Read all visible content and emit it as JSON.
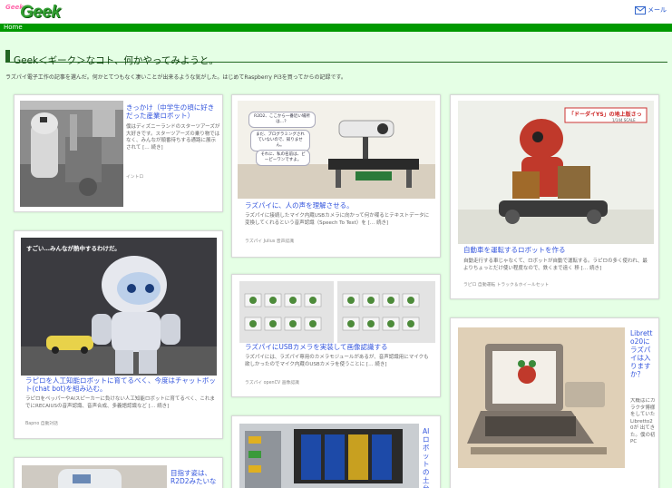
{
  "site": {
    "logo_small": "Geek",
    "logo_big": "Geek",
    "mail_label": "メール",
    "nav_label": "Home"
  },
  "headline": "Geek＜ギーク＞なコト、何かやってみようと。",
  "intro": "ラズパイ電子工作の記事を選んだ。何かとてつもなく凄いことが出来るような気がした。はじめてRaspberry Pi3を買ってからの記録です。",
  "cards": [
    {
      "title": "きっかけ（中学生の頃に好きだった産業ロボット）",
      "desc": "僕はディズニーランドのスターツアーズが大好きです。スターツアーズの乗り物ではなく、みんなが順番待ちする通路に展示されて [… 続き]",
      "tags": "イントロ"
    },
    {
      "title": "ラズパイに、人の声を理解させる。",
      "desc": "ラズパイに接続したマイク内蔵USBカメラに向かって何か喋るとテキストデータに変換してくれるという音声認識（Speech To Text）を [… 続き]",
      "tags": "ラズパイ Julius 音声認識",
      "bubble_1": "R2D2、ここから一番近い場所は…？",
      "bubble_2": "まだ、プログラミングされていないので、知りません。",
      "bubble_3": "それに、私の名前は、ピーピーワンですよ。"
    },
    {
      "title": "自動車を運転するロボットを作る",
      "desc": "自動走行する車じゃなくて、ロボットが自動で運転する。ラピロの多く使われ、最よりちょっとだけ使い程度なので、鉄くまで遠く 移 [… 続き]",
      "tags": "ラピロ 自動運転 トラック＆ホイールセット",
      "sign": "「ドーダイYS」の地上版さっ",
      "sign_sub": "1/144 SCALE"
    },
    {
      "title": "ラピロを人工知能ロボットに育てるべく、今度はチャットボット(chat bot)を組み込む。",
      "desc": "ラピロをペッパーやAIスピーカーに負けない人工知能ロボットに育てるべく、これまでにRECAIUSの音声認識、音声合成、多義語認識など [… 続き]",
      "tags": "Bapno 自動対話",
      "photo_caption": "すごい…みんなが熱中するわけだ。"
    },
    {
      "title": "ラズパイにUSBカメラを実装して画像認識する",
      "desc": "ラズパイには、ラズパイ専用のカメラモジュールがあるが、音声認識用にマイクも欲しかったのでマイク内蔵のUSBカメラを使うことに [… 続き]",
      "tags": "ラズパイ openCV 画像認識"
    },
    {
      "title": "Libretto20にラズパイは入りますか？",
      "desc": "大概はにカラクタ博様をしていた Libretto20が 出てきた。僕の初PC"
    },
    {
      "title": "AIロボットの土台",
      "desc": ""
    },
    {
      "title": "目指す姿は、R2D2みたいな",
      "desc": ""
    }
  ],
  "colors": {
    "background": "#e5ffe5",
    "nav": "#009900",
    "link": "#3355dd"
  }
}
